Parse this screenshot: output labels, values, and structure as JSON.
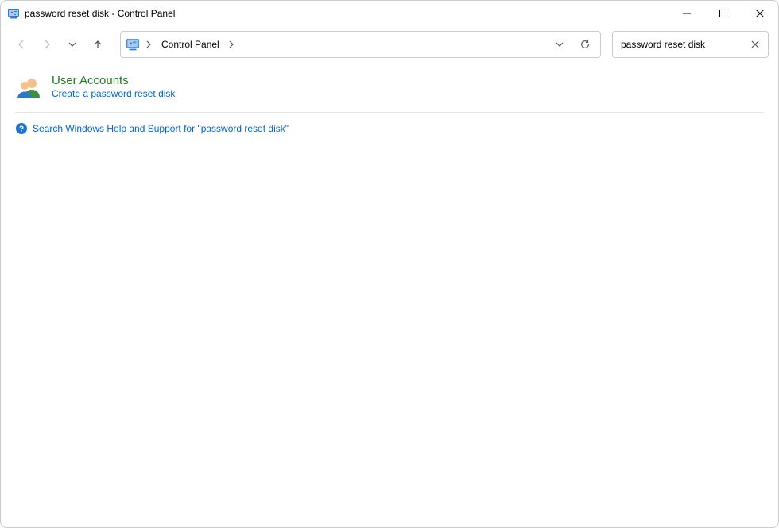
{
  "window": {
    "title": "password reset disk - Control Panel"
  },
  "address": {
    "root_label": "Control Panel"
  },
  "search": {
    "value": "password reset disk"
  },
  "results": {
    "category_title": "User Accounts",
    "task_link": "Create a password reset disk",
    "help_link": "Search Windows Help and Support for \"password reset disk\""
  }
}
